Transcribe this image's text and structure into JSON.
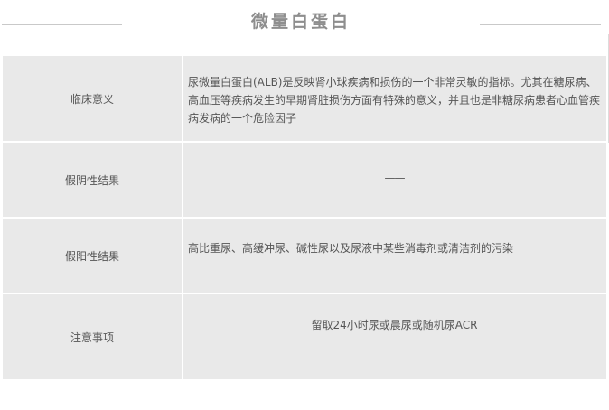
{
  "title": "微量白蛋白",
  "rows": [
    {
      "label": "临床意义",
      "value": "尿微量白蛋白(ALB)是反映肾小球疾病和损伤的一个非常灵敏的指标。尤其在糖尿病、高血压等疾病发生的早期肾脏损伤方面有特殊的意义，并且也是非糖尿病患者心血管疾病发病的一个危险因子"
    },
    {
      "label": "假阴性结果",
      "value": "——"
    },
    {
      "label": "假阳性结果",
      "value": "高比重尿、高缓冲尿、碱性尿以及尿液中某些消毒剂或清洁剂的污染"
    },
    {
      "label": "注意事项",
      "value": "留取24小时尿或晨尿或随机尿ACR"
    }
  ]
}
